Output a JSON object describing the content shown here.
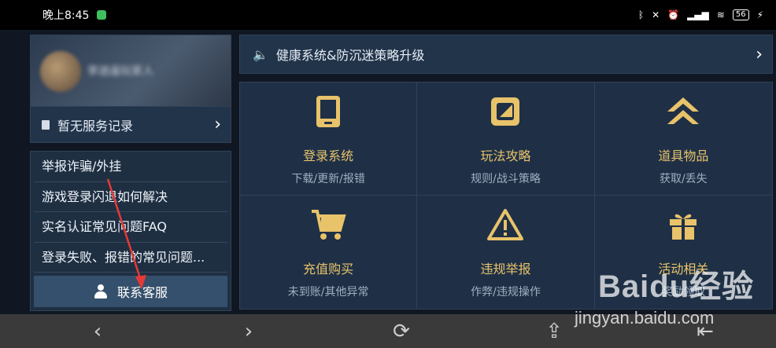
{
  "status_bar": {
    "time": "晚上8:45",
    "battery": "56"
  },
  "profile": {
    "name": "李逍遥玩家人"
  },
  "service_record": {
    "label": "暂无服务记录"
  },
  "faq": {
    "items": [
      "举报诈骗/外挂",
      "游戏登录闪退如何解决",
      "实名认证常见问题FAQ",
      "登录失败、报错的常见问题..."
    ],
    "contact_label": "联系客服"
  },
  "notice": {
    "text": "健康系统&防沉迷策略升级"
  },
  "categories": [
    {
      "title": "登录系统",
      "sub": "下载/更新/报错",
      "icon": "tablet-icon"
    },
    {
      "title": "玩法攻略",
      "sub": "规则/战斗策略",
      "icon": "guide-icon"
    },
    {
      "title": "道具物品",
      "sub": "获取/丢失",
      "icon": "chevron-up-double-icon"
    },
    {
      "title": "充值购买",
      "sub": "未到账/其他异常",
      "icon": "cart-icon"
    },
    {
      "title": "违规举报",
      "sub": "作弊/违规操作",
      "icon": "warning-icon"
    },
    {
      "title": "活动相关",
      "sub": "奖励领取",
      "icon": "gift-icon"
    }
  ],
  "colors": {
    "accent_gold": "#e8c36a",
    "panel": "#1f3046",
    "panel_border": "#2f4259",
    "annotation_red": "#e53935"
  },
  "watermark": {
    "brand": "Baidu经验",
    "url": "jingyan.baidu.com"
  }
}
